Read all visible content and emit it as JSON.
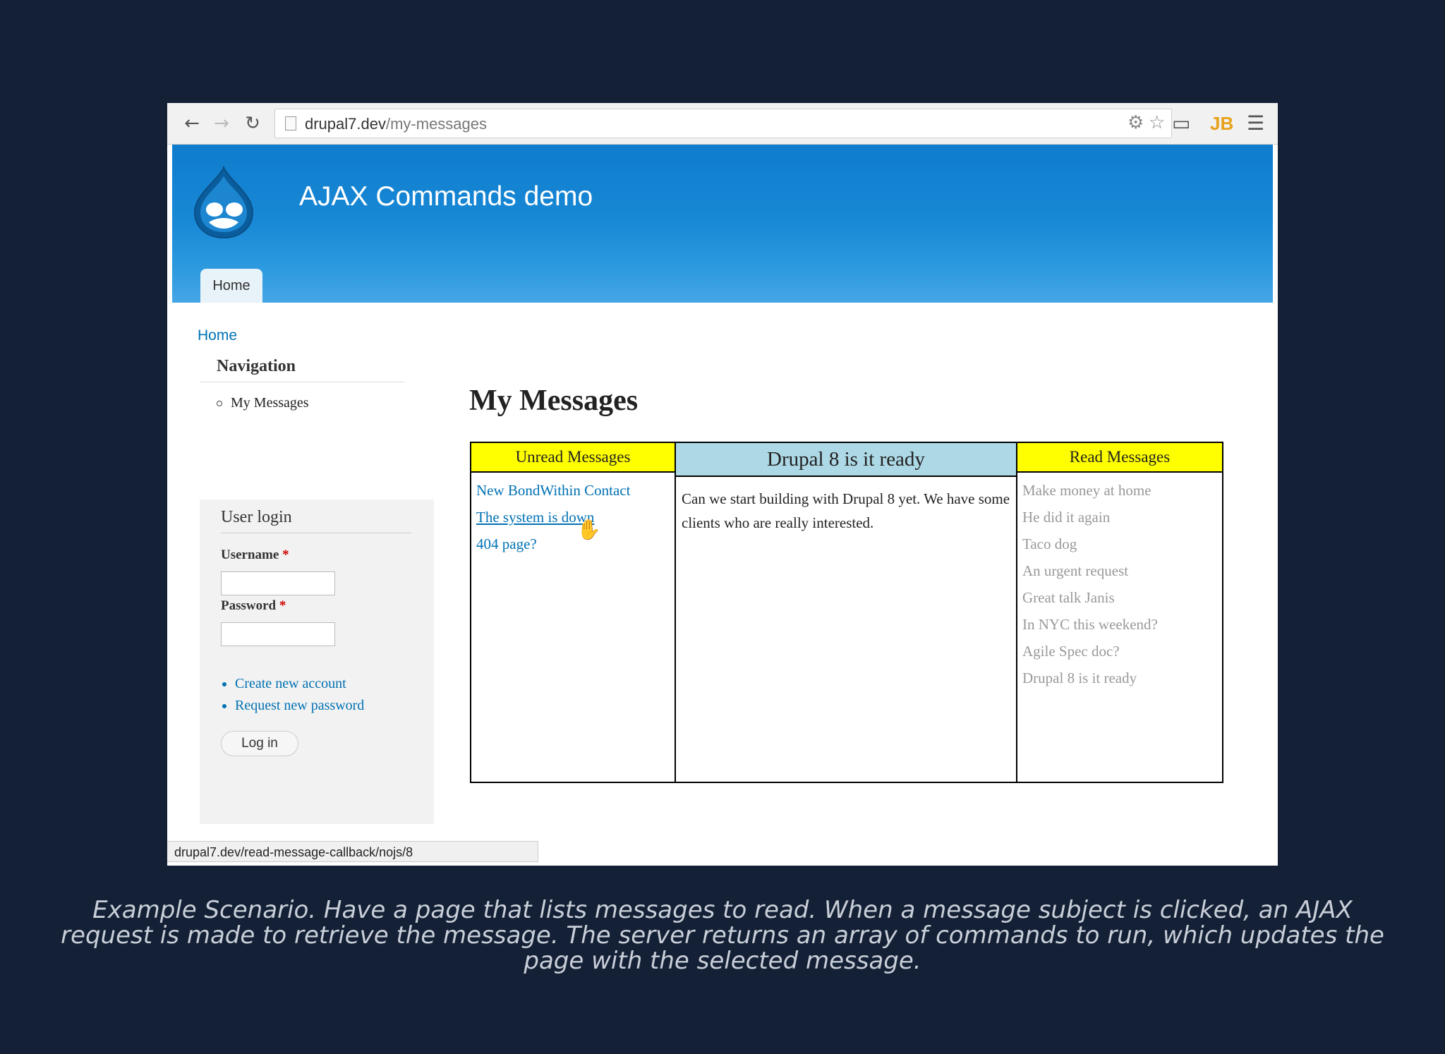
{
  "browser": {
    "url_host": "drupal7.dev",
    "url_path": "/my-messages",
    "status_url": "drupal7.dev/read-message-callback/nojs/8",
    "icons": [
      "back-arrow-icon",
      "forward-arrow-icon",
      "reload-icon",
      "page-icon",
      "extension-icon",
      "star-icon",
      "cast-icon",
      "jb-icon",
      "menu-icon"
    ]
  },
  "site": {
    "name": "AJAX Commands demo",
    "tab_home": "Home",
    "breadcrumb": "Home"
  },
  "sidebar": {
    "nav_title": "Navigation",
    "nav_items": [
      "My Messages"
    ],
    "login_title": "User login",
    "username_label": "Username",
    "password_label": "Password",
    "required_mark": "*",
    "links": [
      "Create new account",
      "Request new password"
    ],
    "login_button": "Log in"
  },
  "main": {
    "title": "My Messages",
    "unread_header": "Unread Messages",
    "unread": [
      "New BondWithin Contact",
      "The system is down",
      "404 page?"
    ],
    "detail_header": "Drupal 8 is it ready",
    "detail_body": "Can we start building with Drupal 8 yet. We have some clients who are really interested.",
    "read_header": "Read Messages",
    "read": [
      "Make money at home",
      "He did it again",
      "Taco dog",
      "An urgent request",
      "Great talk Janis",
      "In NYC this weekend?",
      "Agile Spec doc?",
      "Drupal 8 is it ready"
    ]
  },
  "caption": "Example Scenario. Have a page that lists messages to read. When a message subject is clicked, an AJAX request is made to retrieve the message. The server returns an array of commands to run, which updates the page with the selected message.",
  "colors": {
    "header_blue": "#1889d6",
    "link_blue": "#0071b3",
    "column_yellow": "#ffff00",
    "detail_blue": "#add8e6"
  }
}
